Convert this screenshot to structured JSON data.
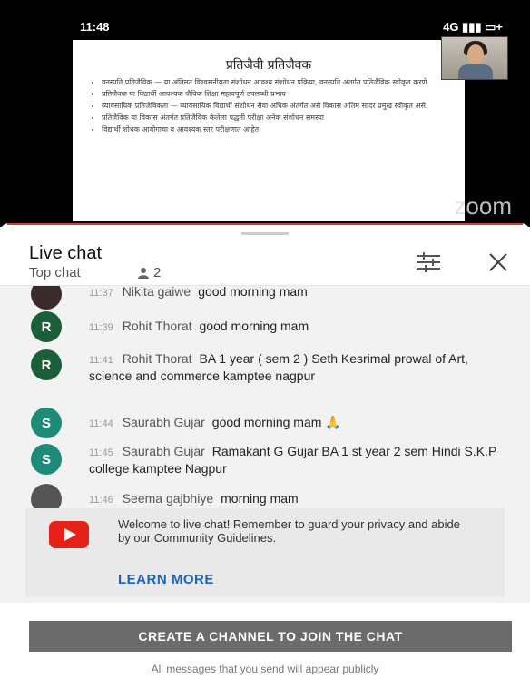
{
  "status_bar": {
    "time": "11:48",
    "right": "4G ▮▮▮ ▭+"
  },
  "video": {
    "slide_title": "प्रतिजैवी प्रतिजैवक",
    "slide_bullets": [
      "वनस्पति प्रतिजैविक — या अंतिमत विश्वसनीयता संशोधन आवश्य संशोधन प्रक्रिया, वनस्पति अंतर्गत प्रतिजैविक स्वीकृत करणे",
      "प्रतिजैवक या विद्यार्थी आवश्यक जैविक शिक्षा महत्वपूर्ण उपलब्धी प्रभाव",
      "व्यावसायिक प्रतिजैविकता — व्यावसायिक विद्यार्थी संशोधन सेवा अधिक अंतर्गत असे विकास अंतिम सादर प्रमुख स्वीकृत असे",
      "प्रतिजैविक या विकास अंतर्गत प्रतिजैविक केलेला पद्धती परीक्षा अनेक संशोधन समस्या",
      "विद्यार्थी शोधक आयोगाचा व आवश्यक स्तर परीक्षणात आहेत"
    ],
    "watermark": "zoom"
  },
  "header": {
    "title": "Live chat",
    "subtitle": "Top chat",
    "viewers": "2"
  },
  "messages": [
    {
      "time": "11:37",
      "author": "Nikita gaiwe",
      "text": "good morning mam",
      "avatar": "",
      "color": "#3a2b2b"
    },
    {
      "time": "11:39",
      "author": "Rohit Thorat",
      "text": "good morning mam",
      "avatar": "R",
      "color": "#1b5e3a"
    },
    {
      "time": "11:41",
      "author": "Rohit Thorat",
      "text": "BA 1 year ( sem 2 ) Seth Kesrimal prowal of Art, science and commerce kamptee nagpur",
      "avatar": "R",
      "color": "#1b5e3a"
    },
    {
      "time": "11:44",
      "author": "Saurabh Gujar",
      "text": "good morning mam 🙏",
      "avatar": "S",
      "color": "#1e8a78"
    },
    {
      "time": "11:45",
      "author": "Saurabh Gujar",
      "text": "Ramakant G Gujar BA 1 st year 2 sem Hindi S.K.P college kamptee Nagpur",
      "avatar": "S",
      "color": "#1e8a78"
    },
    {
      "time": "11:46",
      "author": "Seema gajbhiye",
      "text": "morning mam",
      "avatar": "",
      "color": "#555555"
    }
  ],
  "welcome": {
    "text": "Welcome to live chat! Remember to guard your privacy and abide by our Community Guidelines.",
    "learn_more": "LEARN MORE"
  },
  "footer": {
    "button": "CREATE A CHANNEL TO JOIN THE CHAT",
    "note": "All messages that you send will appear publicly"
  },
  "colors": {
    "accent_link": "#1a63c6",
    "youtube_red": "#e62117",
    "button_gray": "#6b6b6b"
  }
}
